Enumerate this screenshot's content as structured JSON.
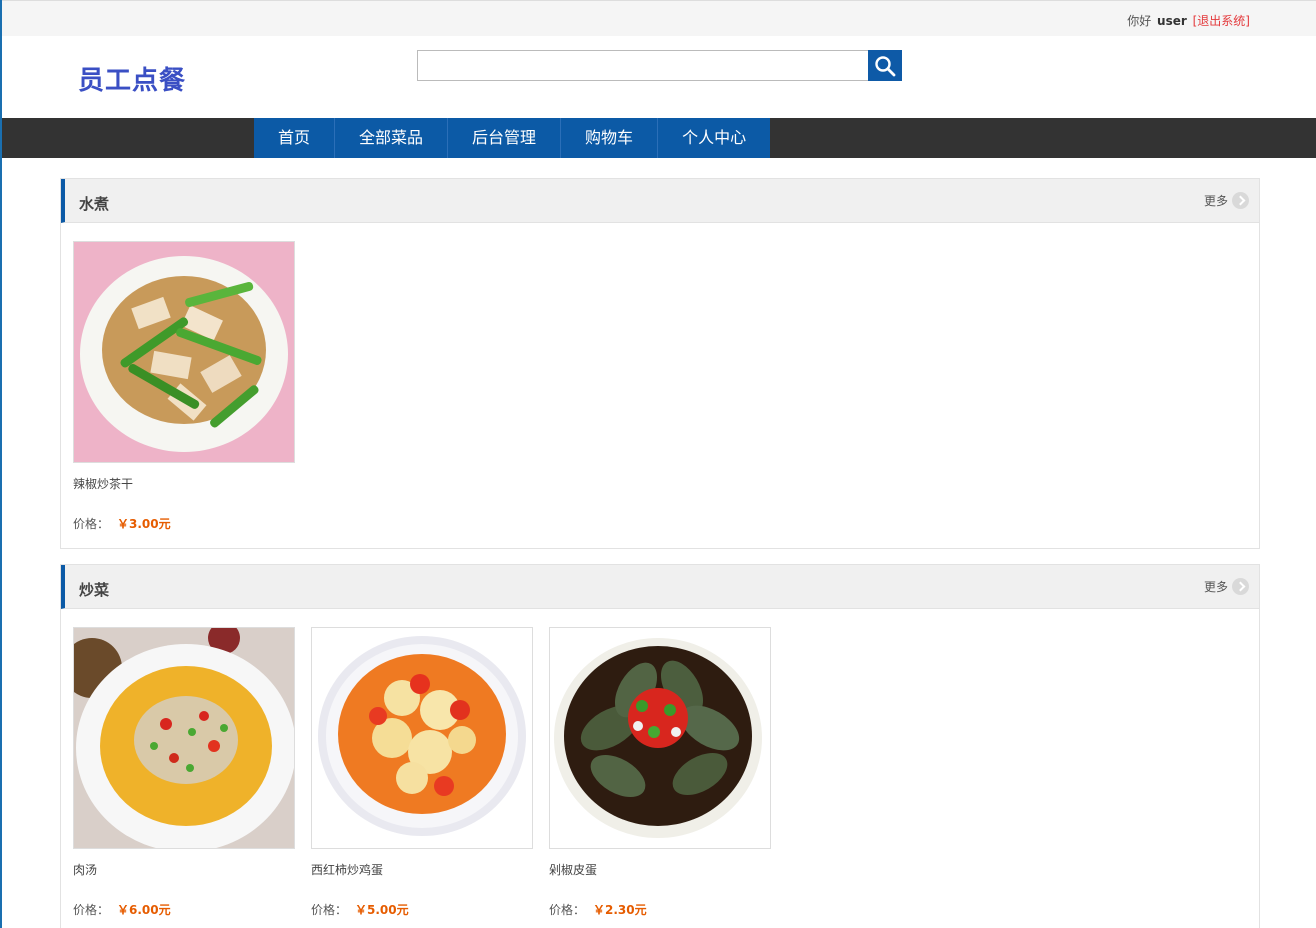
{
  "topbar": {
    "greeting": "你好",
    "username": "user",
    "logout": "[退出系统]"
  },
  "header": {
    "logo": "员工点餐",
    "search_value": "",
    "search_icon": "search-icon"
  },
  "nav": {
    "items": [
      "首页",
      "全部菜品",
      "后台管理",
      "购物车",
      "个人中心"
    ]
  },
  "colors": {
    "accent": "#0c5aa6",
    "navbar": "#333333",
    "logo": "#3a4fc4",
    "price": "#e65c00",
    "logout": "#e4393c"
  },
  "sections": [
    {
      "title": "水煮",
      "more": "更多",
      "items": [
        {
          "name": "辣椒炒茶干",
          "price_label": "价格：",
          "price": "￥3.00元"
        }
      ]
    },
    {
      "title": "炒菜",
      "more": "更多",
      "items": [
        {
          "name": "肉汤",
          "price_label": "价格：",
          "price": "￥6.00元"
        },
        {
          "name": "西红柿炒鸡蛋",
          "price_label": "价格：",
          "price": "￥5.00元"
        },
        {
          "name": "剁椒皮蛋",
          "price_label": "价格：",
          "price": "￥2.30元"
        }
      ]
    }
  ]
}
